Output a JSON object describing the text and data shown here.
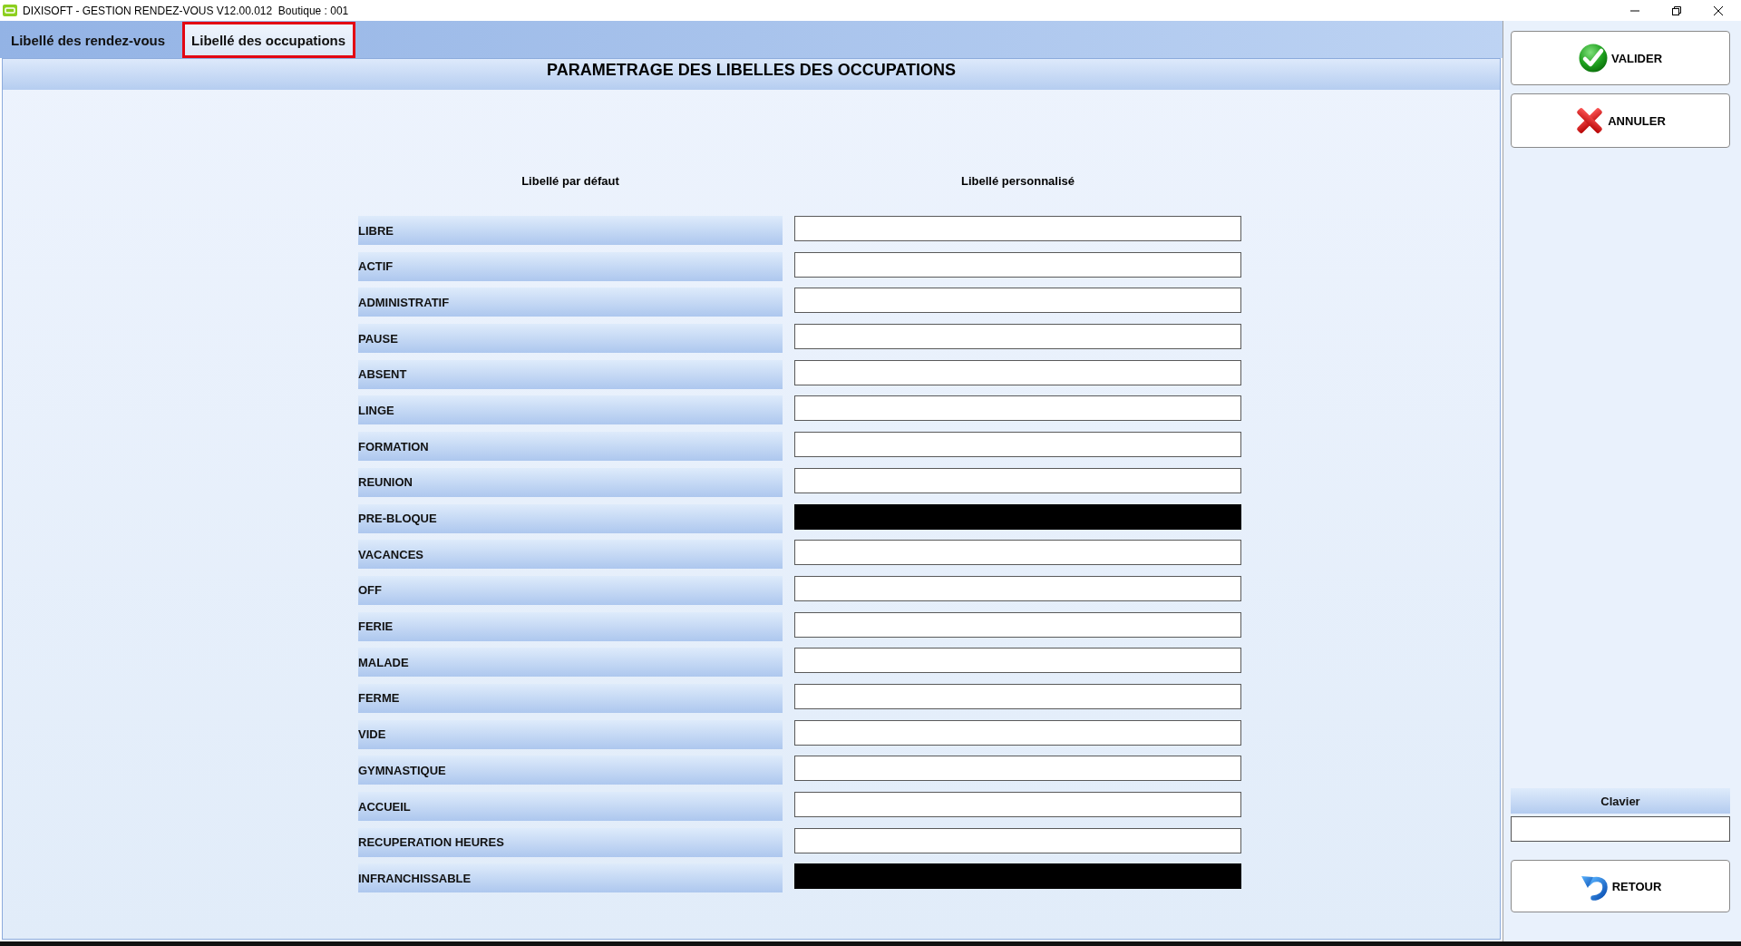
{
  "window": {
    "title": "DIXISOFT - GESTION RENDEZ-VOUS V12.00.012  Boutique : 001"
  },
  "tabs": [
    {
      "label": "Libellé des rendez-vous",
      "selected": false,
      "highlighted": false
    },
    {
      "label": "Libellé des occupations",
      "selected": true,
      "highlighted": true
    }
  ],
  "panel": {
    "title": "PARAMETRAGE DES LIBELLES DES OCCUPATIONS",
    "columns": [
      "Libellé par défaut",
      "Libellé personnalisé"
    ],
    "rows": [
      {
        "label": "LIBRE",
        "disabled": false
      },
      {
        "label": "ACTIF",
        "disabled": false
      },
      {
        "label": "ADMINISTRATIF",
        "disabled": false
      },
      {
        "label": "PAUSE",
        "disabled": false
      },
      {
        "label": "ABSENT",
        "disabled": false
      },
      {
        "label": "LINGE",
        "disabled": false
      },
      {
        "label": "FORMATION",
        "disabled": false
      },
      {
        "label": "REUNION",
        "disabled": false
      },
      {
        "label": "PRE-BLOQUE",
        "disabled": true
      },
      {
        "label": "VACANCES",
        "disabled": false
      },
      {
        "label": "OFF",
        "disabled": false
      },
      {
        "label": "FERIE",
        "disabled": false
      },
      {
        "label": "MALADE",
        "disabled": false
      },
      {
        "label": "FERME",
        "disabled": false
      },
      {
        "label": "VIDE",
        "disabled": false
      },
      {
        "label": "GYMNASTIQUE",
        "disabled": false
      },
      {
        "label": "ACCUEIL",
        "disabled": false
      },
      {
        "label": "RECUPERATION HEURES",
        "disabled": false
      },
      {
        "label": "INFRANCHISSABLE",
        "disabled": true
      }
    ]
  },
  "side": {
    "buttons": [
      {
        "label": "VALIDER",
        "kind": "check"
      },
      {
        "label": "ANNULER",
        "kind": "cross"
      }
    ],
    "keyboard": {
      "label": "Clavier"
    },
    "back_button": {
      "label": "RETOUR"
    }
  }
}
